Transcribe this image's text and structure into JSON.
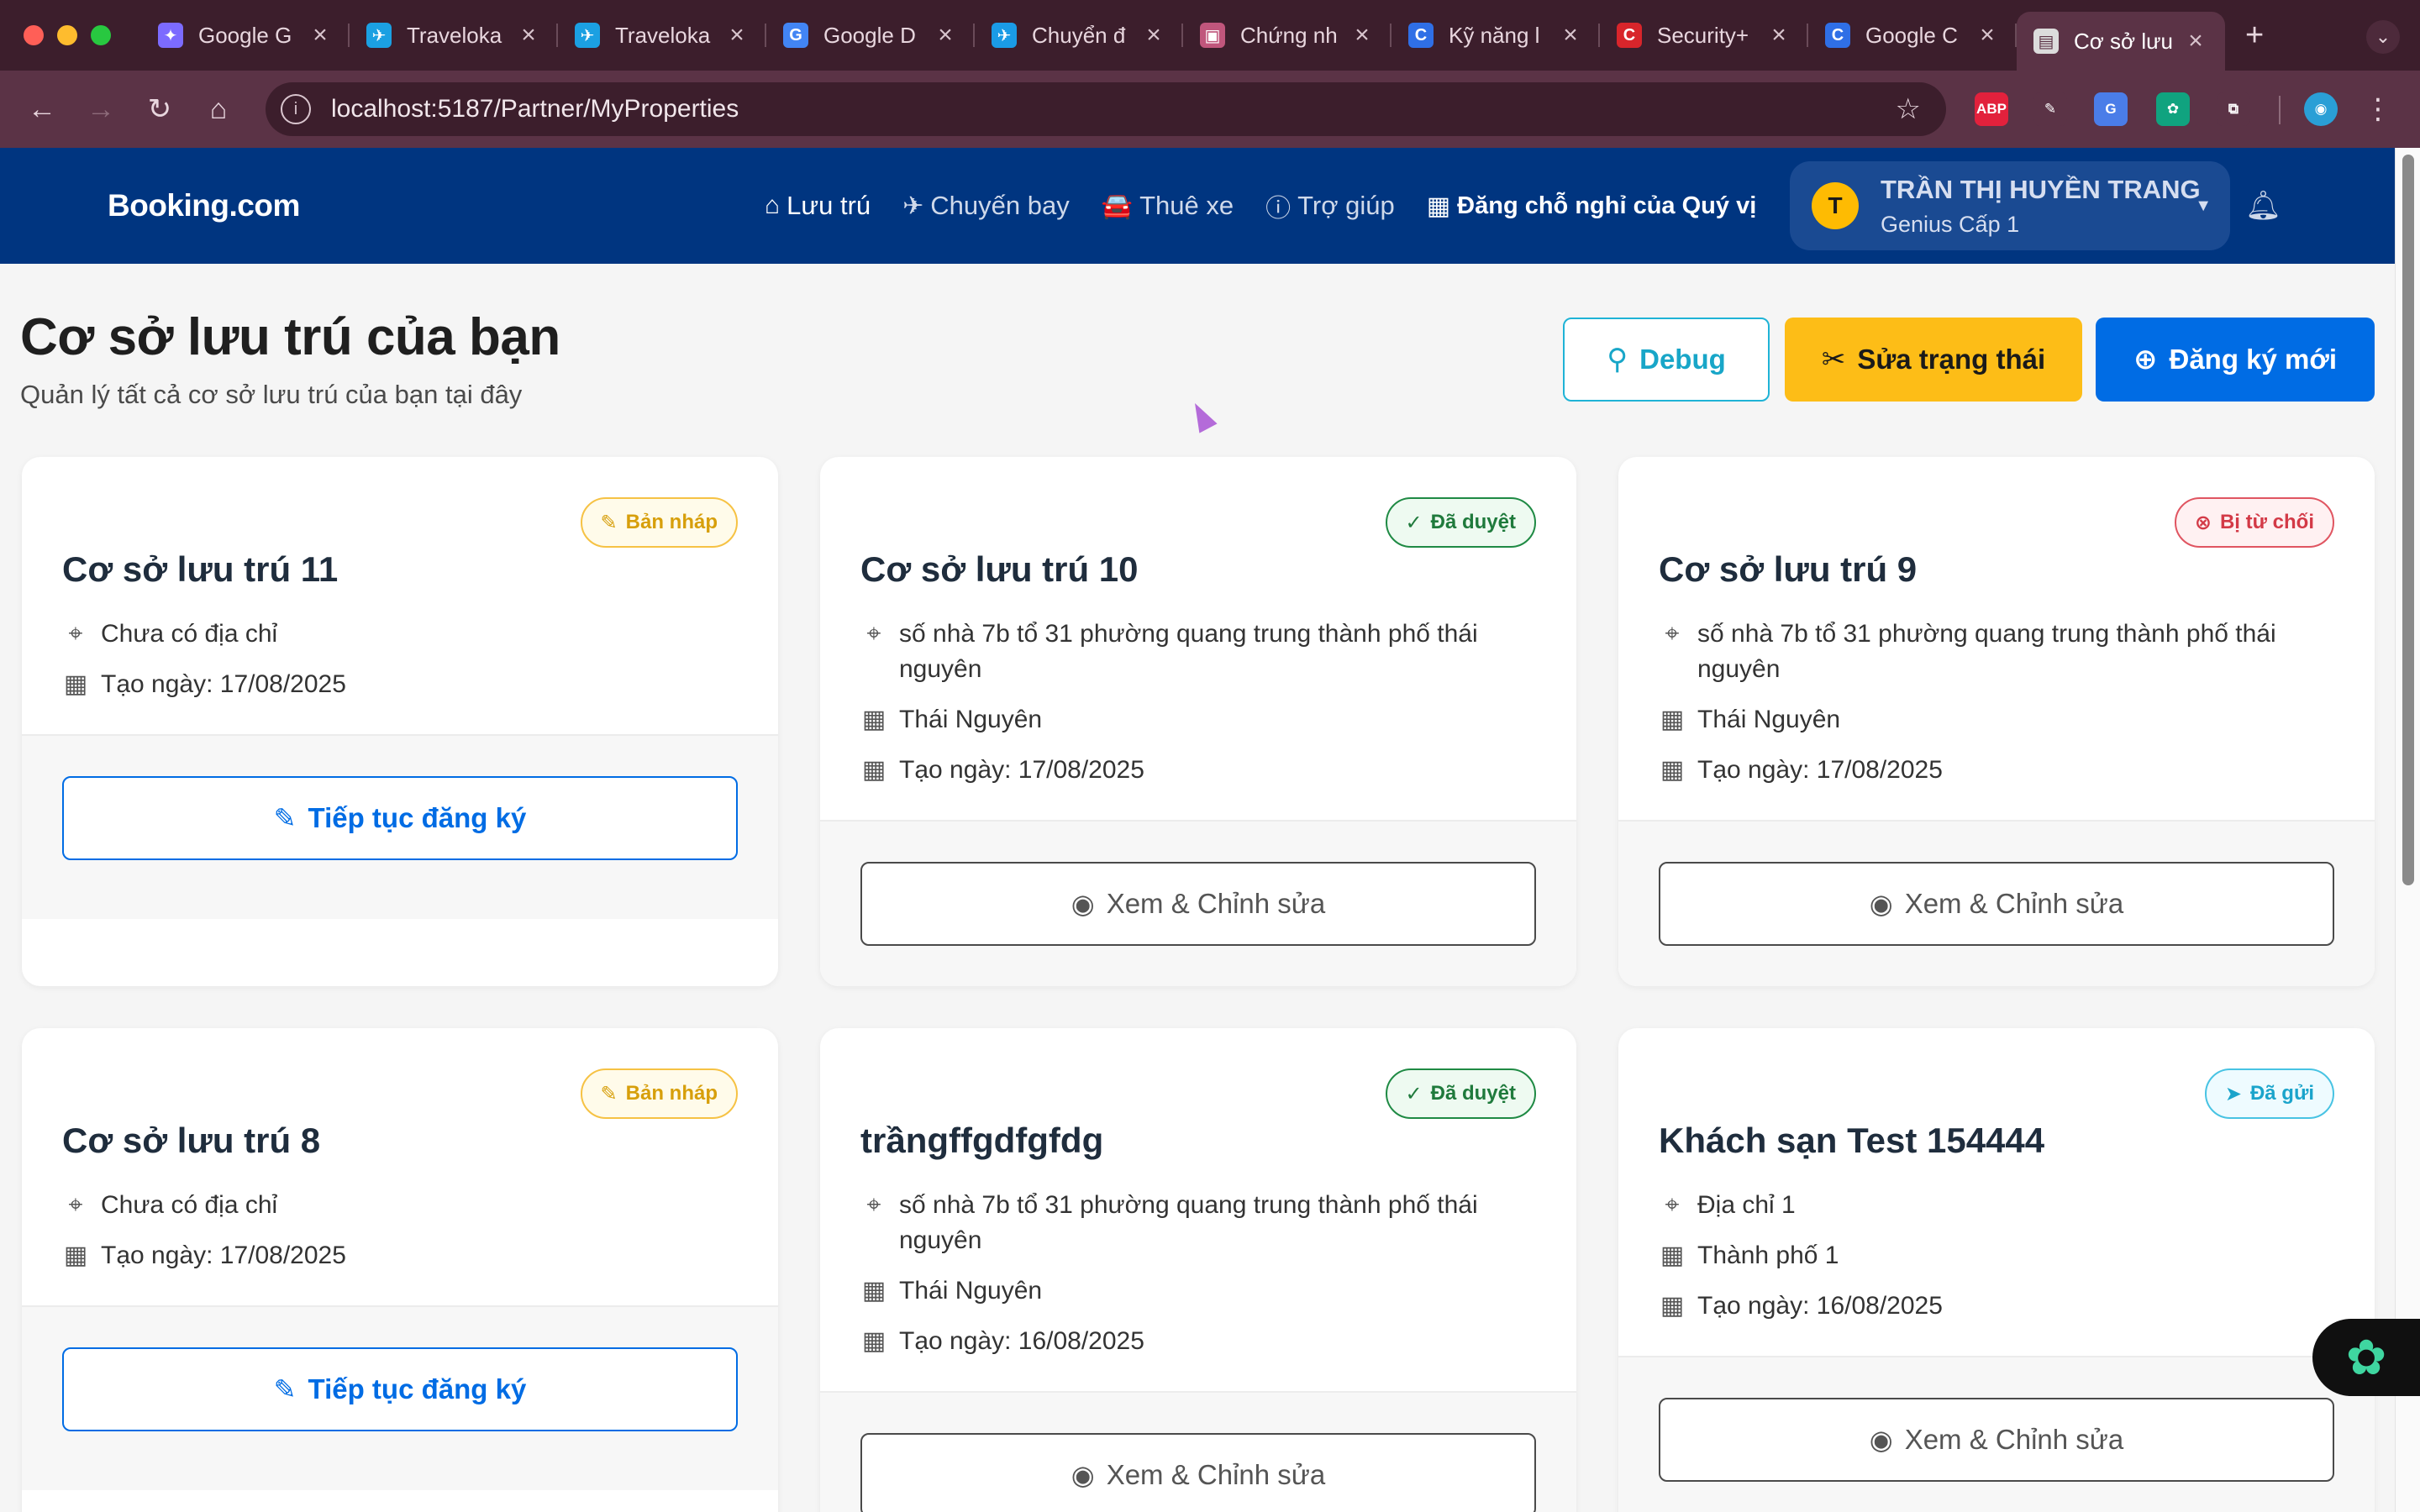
{
  "browser": {
    "traffic_lights": [
      "#ff5f57",
      "#febc2e",
      "#28c840"
    ],
    "tabs": [
      {
        "title": "Google G",
        "icon": "gemini-icon",
        "color": "#7c6bff",
        "glyph": "✦"
      },
      {
        "title": "Traveloka",
        "icon": "traveloka-icon",
        "color": "#1ba0e2",
        "glyph": "✈"
      },
      {
        "title": "Traveloka",
        "icon": "traveloka-icon",
        "color": "#1ba0e2",
        "glyph": "✈"
      },
      {
        "title": "Google D",
        "icon": "google-translate-icon",
        "color": "#4285f4",
        "glyph": "G"
      },
      {
        "title": "Chuyển đ",
        "icon": "plane-circle-icon",
        "color": "#1a9be6",
        "glyph": "✈"
      },
      {
        "title": "Chứng nh",
        "icon": "image-icon",
        "color": "#c0567c",
        "glyph": "▣"
      },
      {
        "title": "Kỹ năng l",
        "icon": "c-brand-icon",
        "color": "#2f6fe6",
        "glyph": "C"
      },
      {
        "title": "Security+",
        "icon": "c-red-icon",
        "color": "#d8252b",
        "glyph": "C"
      },
      {
        "title": "Google C",
        "icon": "c-brand-icon",
        "color": "#2f6fe6",
        "glyph": "C"
      },
      {
        "title": "Cơ sở lưu",
        "icon": "document-icon",
        "color": "#dcdcdc",
        "glyph": "▤",
        "active": true
      }
    ],
    "url": "localhost:5187/Partner/MyProperties",
    "extensions": [
      {
        "name": "adblock-icon",
        "label": "ABP",
        "color": "#e2213c"
      },
      {
        "name": "eyedropper-icon",
        "label": "✎",
        "color": "#5b3346"
      },
      {
        "name": "translate-icon",
        "label": "G",
        "color": "#4a7de8"
      },
      {
        "name": "chatgpt-icon",
        "label": "✿",
        "color": "#10a37f"
      },
      {
        "name": "puzzle-icon",
        "label": "⧉",
        "color": "#5b3346"
      },
      {
        "name": "profile-icon",
        "label": "◉",
        "color": "#2a9fd6"
      }
    ]
  },
  "header": {
    "logo": "Booking.com",
    "nav": [
      {
        "label": "Lưu trú",
        "icon": "home-icon",
        "glyph": "⌂",
        "active": true
      },
      {
        "label": "Chuyến bay",
        "icon": "plane-icon",
        "glyph": "✈"
      },
      {
        "label": "Thuê xe",
        "icon": "car-icon",
        "glyph": "🚘"
      },
      {
        "label": "Trợ giúp",
        "icon": "help-icon",
        "glyph": "ⓘ"
      }
    ],
    "list_property": "Đăng chỗ nghỉ của Quý vị",
    "user": {
      "initial": "T",
      "name": "TRẦN THỊ HUYỀN TRANG",
      "level": "Genius Cấp 1"
    },
    "brand_color": "#003580"
  },
  "page": {
    "title": "Cơ sở lưu trú của bạn",
    "subtitle": "Quản lý tất cả cơ sở lưu trú của bạn tại đây",
    "buttons": {
      "debug": "Debug",
      "fix_status": "Sửa trạng thái",
      "register_new": "Đăng ký mới"
    }
  },
  "properties": [
    {
      "name": "Cơ sở lưu trú 11",
      "status": "Bản nháp",
      "status_type": "draft",
      "address": "Chưa có địa chỉ",
      "city": "",
      "created": "Tạo ngày: 17/08/2025",
      "action": "Tiếp tục đăng ký"
    },
    {
      "name": "Cơ sở lưu trú 10",
      "status": "Đã duyệt",
      "status_type": "approved",
      "address": "số nhà 7b tổ 31 phường quang trung thành phố thái nguyên",
      "city": "Thái Nguyên",
      "created": "Tạo ngày: 17/08/2025",
      "action": "Xem & Chỉnh sửa"
    },
    {
      "name": "Cơ sở lưu trú 9",
      "status": "Bị từ chối",
      "status_type": "rejected",
      "address": "số nhà 7b tổ 31 phường quang trung thành phố thái nguyên",
      "city": "Thái Nguyên",
      "created": "Tạo ngày: 17/08/2025",
      "action": "Xem & Chỉnh sửa"
    },
    {
      "name": "Cơ sở lưu trú 8",
      "status": "Bản nháp",
      "status_type": "draft",
      "address": "Chưa có địa chỉ",
      "city": "",
      "created": "Tạo ngày: 17/08/2025",
      "action": "Tiếp tục đăng ký"
    },
    {
      "name": "trầngffgdfgfdg",
      "status": "Đã duyệt",
      "status_type": "approved",
      "address": "số nhà 7b tổ 31 phường quang trung thành phố thái nguyên",
      "city": "Thái Nguyên",
      "created": "Tạo ngày: 16/08/2025",
      "action": "Xem & Chỉnh sửa"
    },
    {
      "name": "Khách sạn Test 154444",
      "status": "Đã gửi",
      "status_type": "sent",
      "address": "Địa chỉ 1",
      "city": "Thành phố 1",
      "created": "Tạo ngày: 16/08/2025",
      "action": "Xem & Chỉnh sửa"
    }
  ]
}
